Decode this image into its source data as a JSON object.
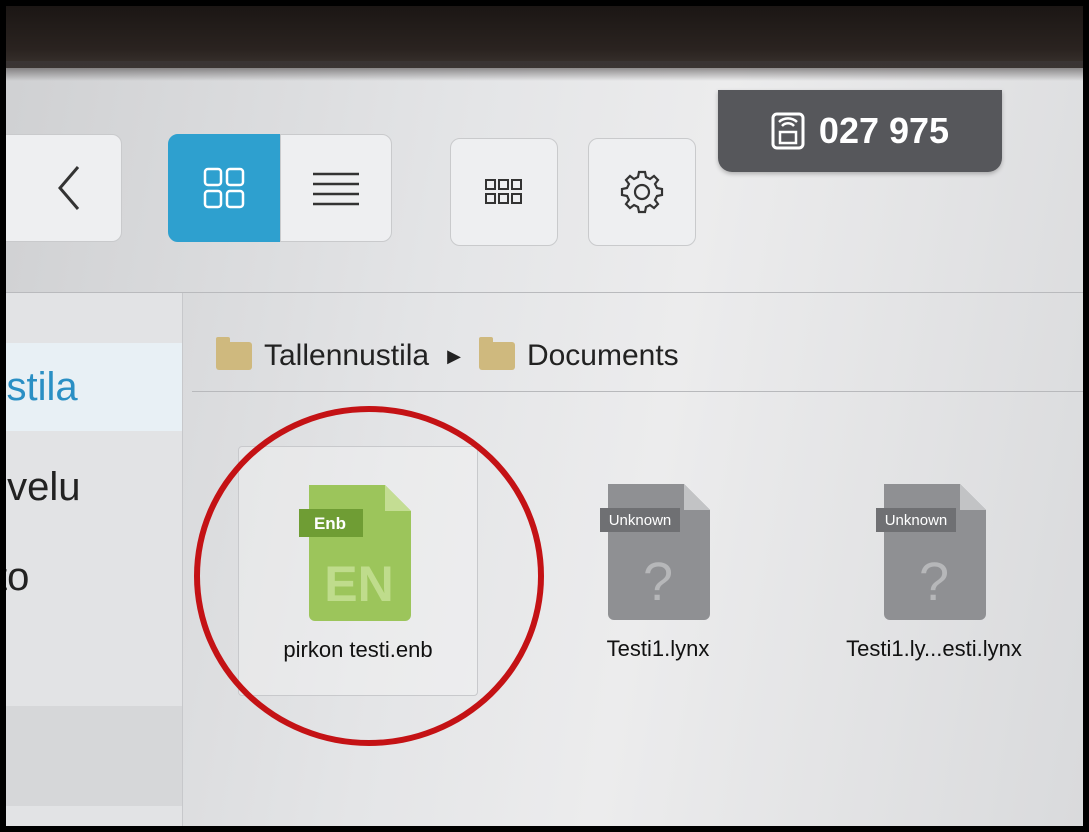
{
  "toolbar": {
    "back_icon": "chevron-left-icon",
    "grid_view_icon": "grid-view-icon",
    "list_view_icon": "list-view-icon",
    "apps_icon": "apps-grid-icon",
    "settings_icon": "gear-icon",
    "active_view_color": "#2ea0cf"
  },
  "room_code": {
    "icon": "cast-icon",
    "value": "027 975"
  },
  "sidebar": {
    "items": [
      {
        "label": "nustila",
        "selected": true
      },
      {
        "label": "alvelu",
        "selected": false
      },
      {
        "label": "sto",
        "selected": false
      }
    ]
  },
  "breadcrumb": {
    "items": [
      "Tallennustila",
      "Documents"
    ]
  },
  "files": [
    {
      "name": "pirkon testi.enb",
      "tag": "Enb",
      "glyph": "EN",
      "color": "#9cc55b",
      "selected": true
    },
    {
      "name": "Testi1.lynx",
      "tag": "Unknown",
      "glyph": "?",
      "color": "#8f9093"
    },
    {
      "name": "Testi1.ly...esti.lynx",
      "tag": "Unknown",
      "glyph": "?",
      "color": "#8f9093"
    }
  ],
  "annotation_color": "#c41215"
}
